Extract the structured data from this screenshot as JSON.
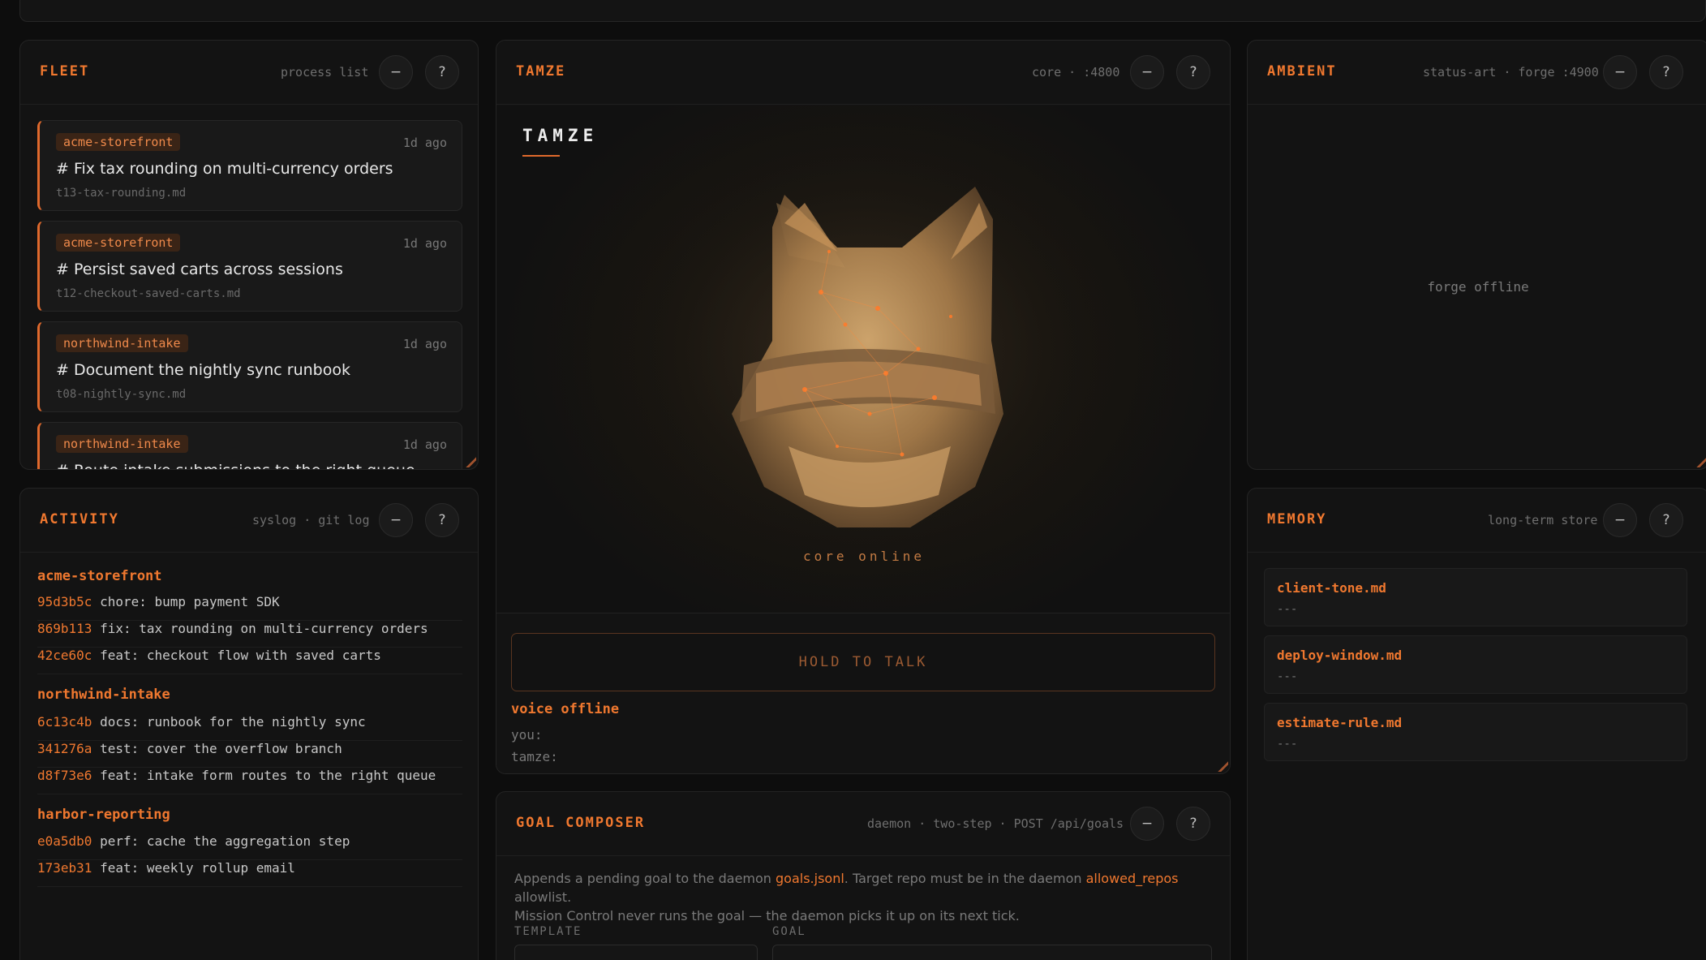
{
  "fleet": {
    "title": "FLEET",
    "meta": "process list",
    "minimize_label": "−",
    "help_label": "?",
    "cards": [
      {
        "repo": "acme-storefront",
        "ago": "1d ago",
        "title": "# Fix tax rounding on multi-currency orders",
        "file": "t13-tax-rounding.md"
      },
      {
        "repo": "acme-storefront",
        "ago": "1d ago",
        "title": "# Persist saved carts across sessions",
        "file": "t12-checkout-saved-carts.md"
      },
      {
        "repo": "northwind-intake",
        "ago": "1d ago",
        "title": "# Document the nightly sync runbook",
        "file": "t08-nightly-sync.md"
      },
      {
        "repo": "northwind-intake",
        "ago": "1d ago",
        "title": "# Route intake submissions to the right queue",
        "file": ""
      }
    ]
  },
  "activity": {
    "title": "ACTIVITY",
    "meta": "syslog · git log",
    "minimize_label": "−",
    "help_label": "?",
    "groups": [
      {
        "repo": "acme-storefront",
        "commits": [
          {
            "hash": "95d3b5c",
            "msg": "chore: bump payment SDK"
          },
          {
            "hash": "869b113",
            "msg": "fix: tax rounding on multi-currency orders"
          },
          {
            "hash": "42ce60c",
            "msg": "feat: checkout flow with saved carts"
          }
        ]
      },
      {
        "repo": "northwind-intake",
        "commits": [
          {
            "hash": "6c13c4b",
            "msg": "docs: runbook for the nightly sync"
          },
          {
            "hash": "341276a",
            "msg": "test: cover the overflow branch"
          },
          {
            "hash": "d8f73e6",
            "msg": "feat: intake form routes to the right queue"
          }
        ]
      },
      {
        "repo": "harbor-reporting",
        "commits": [
          {
            "hash": "e0a5db0",
            "msg": "perf: cache the aggregation step"
          },
          {
            "hash": "173eb31",
            "msg": "feat: weekly rollup email"
          }
        ]
      }
    ]
  },
  "tamze": {
    "title": "TAMZE",
    "meta": "core · :4800",
    "minimize_label": "−",
    "help_label": "?",
    "wordmark": "TAMZE",
    "status": "core online",
    "hold_label": "HOLD TO TALK",
    "voice_status": "voice offline",
    "you_label": "you:",
    "tamze_label": "tamze:"
  },
  "ambient": {
    "title": "AMBIENT",
    "meta": "status-art · forge :4900",
    "minimize_label": "−",
    "help_label": "?",
    "status": "forge offline"
  },
  "memory": {
    "title": "MEMORY",
    "meta": "long-term store",
    "minimize_label": "−",
    "help_label": "?",
    "items": [
      {
        "name": "client-tone.md",
        "value": "---"
      },
      {
        "name": "deploy-window.md",
        "value": "---"
      },
      {
        "name": "estimate-rule.md",
        "value": "---"
      }
    ]
  },
  "goal": {
    "title": "GOAL COMPOSER",
    "meta": "daemon · two-step · POST /api/goals",
    "minimize_label": "−",
    "help_label": "?",
    "desc_1": "Appends a pending goal to the daemon ",
    "desc_hl_1": "goals.jsonl",
    "desc_2": ". Target repo must be in the daemon ",
    "desc_hl_2": "allowed_repos",
    "desc_3": " allowlist.",
    "desc_4": "Mission Control never runs the goal — the daemon picks it up on its next tick.",
    "template_label": "TEMPLATE",
    "goal_label": "GOAL"
  },
  "colors": {
    "accent": "#f0782f",
    "background": "#0d0d0d",
    "panel": "#131313"
  }
}
